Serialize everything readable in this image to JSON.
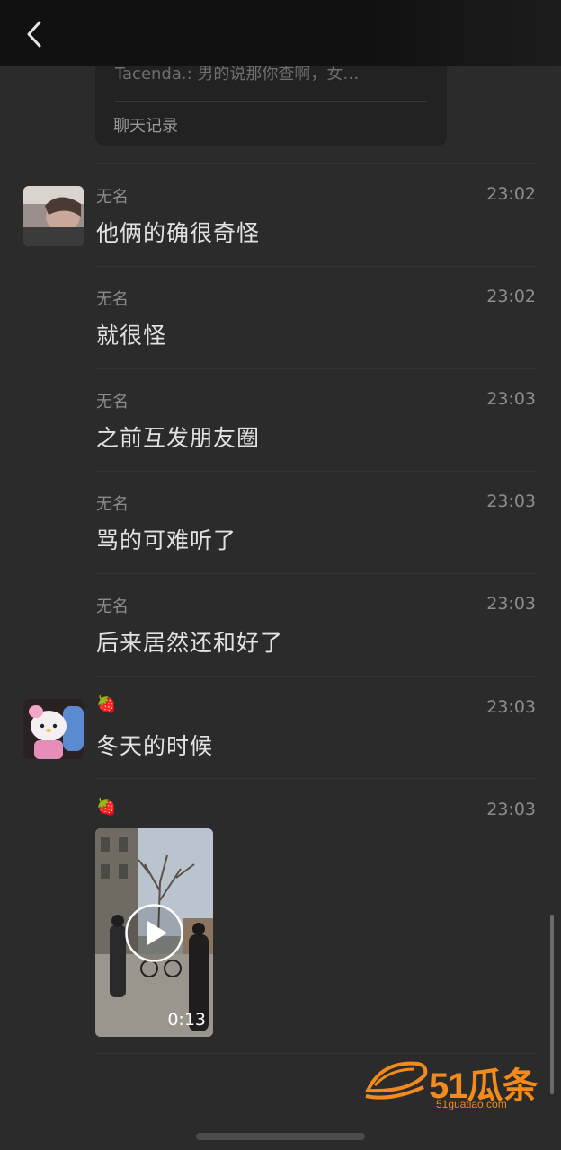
{
  "header": {
    "back_icon": "chevron-left-icon"
  },
  "quote_card": {
    "text": "Tacenda.: 男的说那你查啊，女…",
    "footer": "聊天记录"
  },
  "messages": [
    {
      "sender": "无名",
      "time": "23:02",
      "text": "他俩的确很奇怪"
    },
    {
      "sender": "无名",
      "time": "23:02",
      "text": "就很怪"
    },
    {
      "sender": "无名",
      "time": "23:03",
      "text": "之前互发朋友圈"
    },
    {
      "sender": "无名",
      "time": "23:03",
      "text": "骂的可难听了"
    },
    {
      "sender": "无名",
      "time": "23:03",
      "text": "后来居然还和好了"
    },
    {
      "sender": "🍓",
      "time": "23:03",
      "text": "冬天的时候"
    },
    {
      "sender": "🍓",
      "time": "23:03",
      "video_duration": "0:13"
    }
  ],
  "watermark": {
    "brand": "51瓜条",
    "url": "51guatiao.com",
    "color": "#f28a1c"
  },
  "colors": {
    "background": "#2b2b2b",
    "header": "#111111",
    "text": "#e2e2e2",
    "meta": "#8d8d8d"
  }
}
